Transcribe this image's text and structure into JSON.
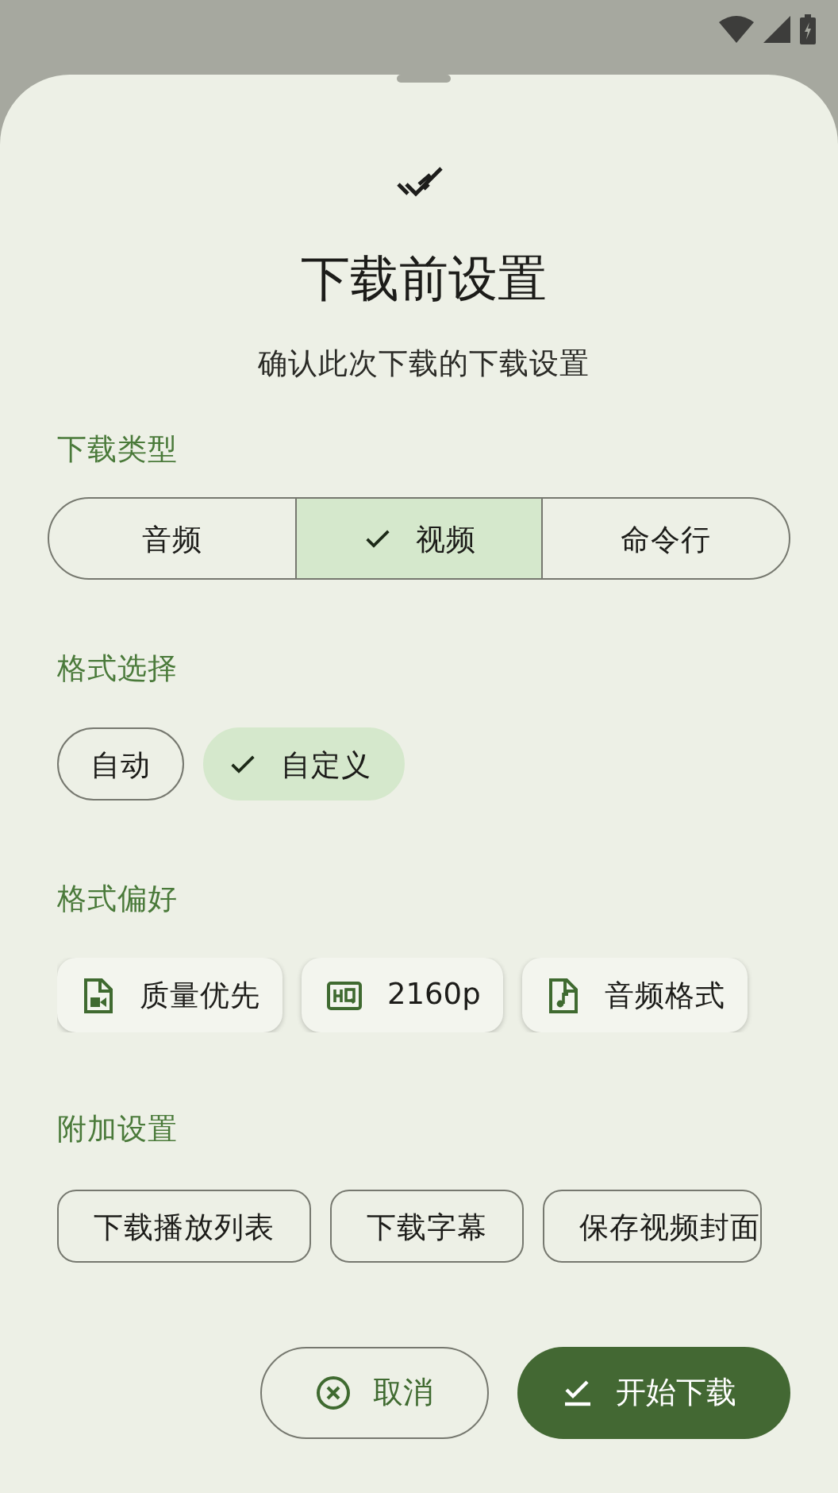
{
  "header": {
    "title": "下载前设置",
    "subtitle": "确认此次下载的下载设置"
  },
  "download_type": {
    "label": "下载类型",
    "segments": [
      {
        "label": "音频",
        "selected": false
      },
      {
        "label": "视频",
        "selected": true
      },
      {
        "label": "命令行",
        "selected": false
      }
    ]
  },
  "format_selection": {
    "label": "格式选择",
    "chips": [
      {
        "label": "自动",
        "selected": false
      },
      {
        "label": "自定义",
        "selected": true
      }
    ]
  },
  "format_preference": {
    "label": "格式偏好",
    "chips": [
      {
        "label": "质量优先",
        "kind": "video_file"
      },
      {
        "label": "2160p",
        "kind": "hq"
      },
      {
        "label": "音频格式",
        "kind": "audio_file"
      }
    ]
  },
  "extra_settings": {
    "label": "附加设置",
    "chips": [
      {
        "label": "下载播放列表",
        "selected": false
      },
      {
        "label": "下载字幕",
        "selected": false
      },
      {
        "label": "保存视频封面",
        "selected": false
      }
    ]
  },
  "actions": [
    {
      "label": "取消",
      "kind": "cancel"
    },
    {
      "label": "开始下载",
      "kind": "confirm"
    }
  ]
}
